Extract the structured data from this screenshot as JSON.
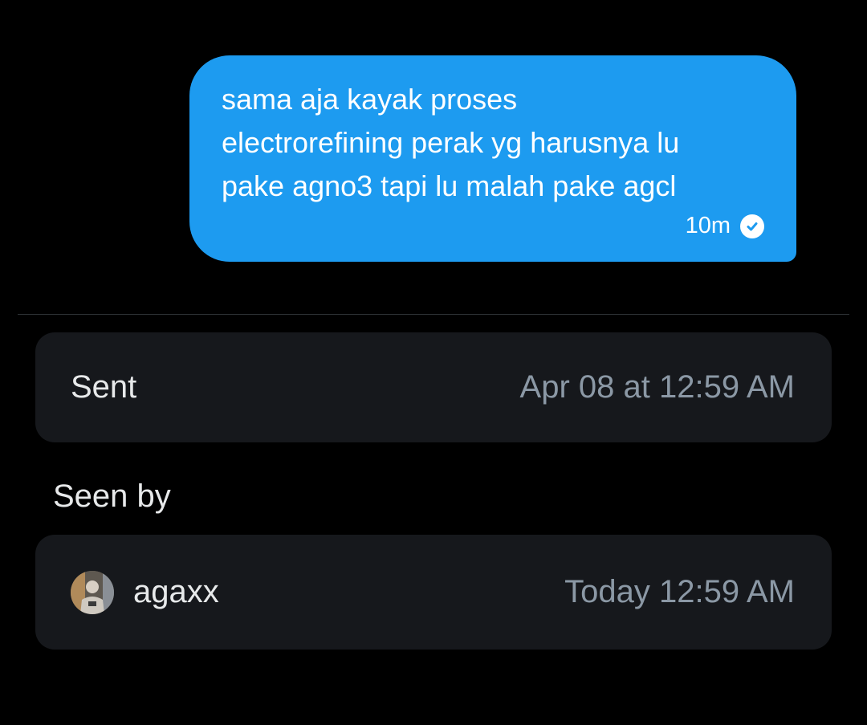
{
  "message": {
    "text": "sama aja kayak proses\nelectrorefining perak yg harusnya lu\npake agno3 tapi lu malah pake agcl",
    "time": "10m",
    "status_icon": "check-circle-icon",
    "bubble_color": "#1d9bf0"
  },
  "sent": {
    "label": "Sent",
    "value": "Apr 08 at 12:59 AM"
  },
  "seen_by": {
    "title": "Seen by",
    "users": [
      {
        "name": "agaxx",
        "time": "Today 12:59 AM",
        "avatar_icon": "user-avatar"
      }
    ]
  },
  "colors": {
    "background": "#000000",
    "card": "#16181c",
    "primary_text": "#e7e9ea",
    "secondary_text": "#8b98a5",
    "divider": "#2f3336"
  }
}
